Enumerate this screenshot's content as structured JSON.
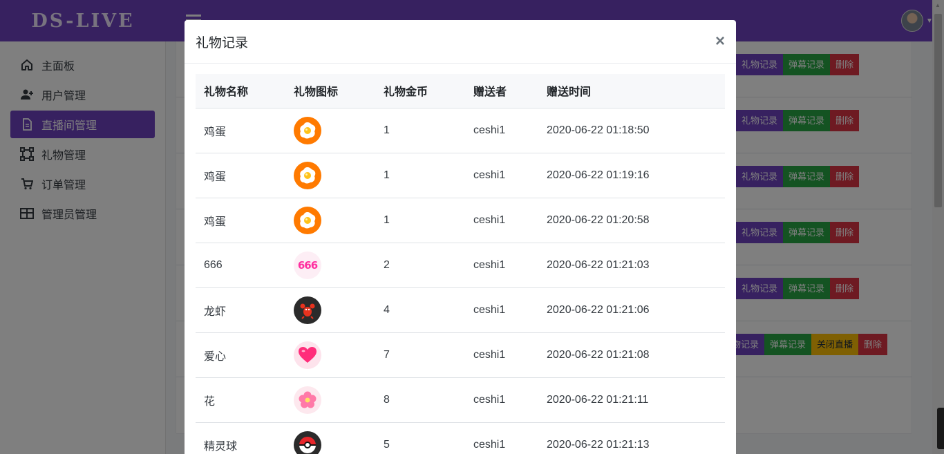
{
  "app": {
    "brand": "DS-LIVE"
  },
  "sidebar": {
    "items": [
      {
        "label": "主面板",
        "icon": "home-icon"
      },
      {
        "label": "用户管理",
        "icon": "user-add-icon"
      },
      {
        "label": "直播间管理",
        "icon": "document-icon",
        "active": true
      },
      {
        "label": "礼物管理",
        "icon": "vector-square-icon"
      },
      {
        "label": "订单管理",
        "icon": "cart-icon"
      },
      {
        "label": "管理员管理",
        "icon": "table-icon"
      }
    ]
  },
  "background_rows": {
    "gift_record": "礼物记录",
    "gift_record_partial": "物记录",
    "danmu_record": "弹幕记录",
    "close_live": "关闭直播",
    "delete": "删除"
  },
  "colors": {
    "primary": "#6f42c1",
    "success": "#28a745",
    "danger": "#dc3545",
    "warning": "#ffc107"
  },
  "modal": {
    "title": "礼物记录",
    "close_symbol": "×",
    "columns": [
      "礼物名称",
      "礼物图标",
      "礼物金币",
      "赠送者",
      "赠送时间"
    ],
    "rows": [
      {
        "name": "鸡蛋",
        "icon": "egg-icon",
        "coins": "1",
        "sender": "ceshi1",
        "time": "2020-06-22 01:18:50"
      },
      {
        "name": "鸡蛋",
        "icon": "egg-icon",
        "coins": "1",
        "sender": "ceshi1",
        "time": "2020-06-22 01:19:16"
      },
      {
        "name": "鸡蛋",
        "icon": "egg-icon",
        "coins": "1",
        "sender": "ceshi1",
        "time": "2020-06-22 01:20:58"
      },
      {
        "name": "666",
        "icon": "666-icon",
        "icon_text": "666",
        "coins": "2",
        "sender": "ceshi1",
        "time": "2020-06-22 01:21:03"
      },
      {
        "name": "龙虾",
        "icon": "lobster-icon",
        "coins": "4",
        "sender": "ceshi1",
        "time": "2020-06-22 01:21:06"
      },
      {
        "name": "爱心",
        "icon": "heart-icon",
        "coins": "7",
        "sender": "ceshi1",
        "time": "2020-06-22 01:21:08"
      },
      {
        "name": "花",
        "icon": "flower-icon",
        "coins": "8",
        "sender": "ceshi1",
        "time": "2020-06-22 01:21:11"
      },
      {
        "name": "精灵球",
        "icon": "pokeball-icon",
        "coins": "5",
        "sender": "ceshi1",
        "time": "2020-06-22 01:21:13"
      }
    ]
  }
}
